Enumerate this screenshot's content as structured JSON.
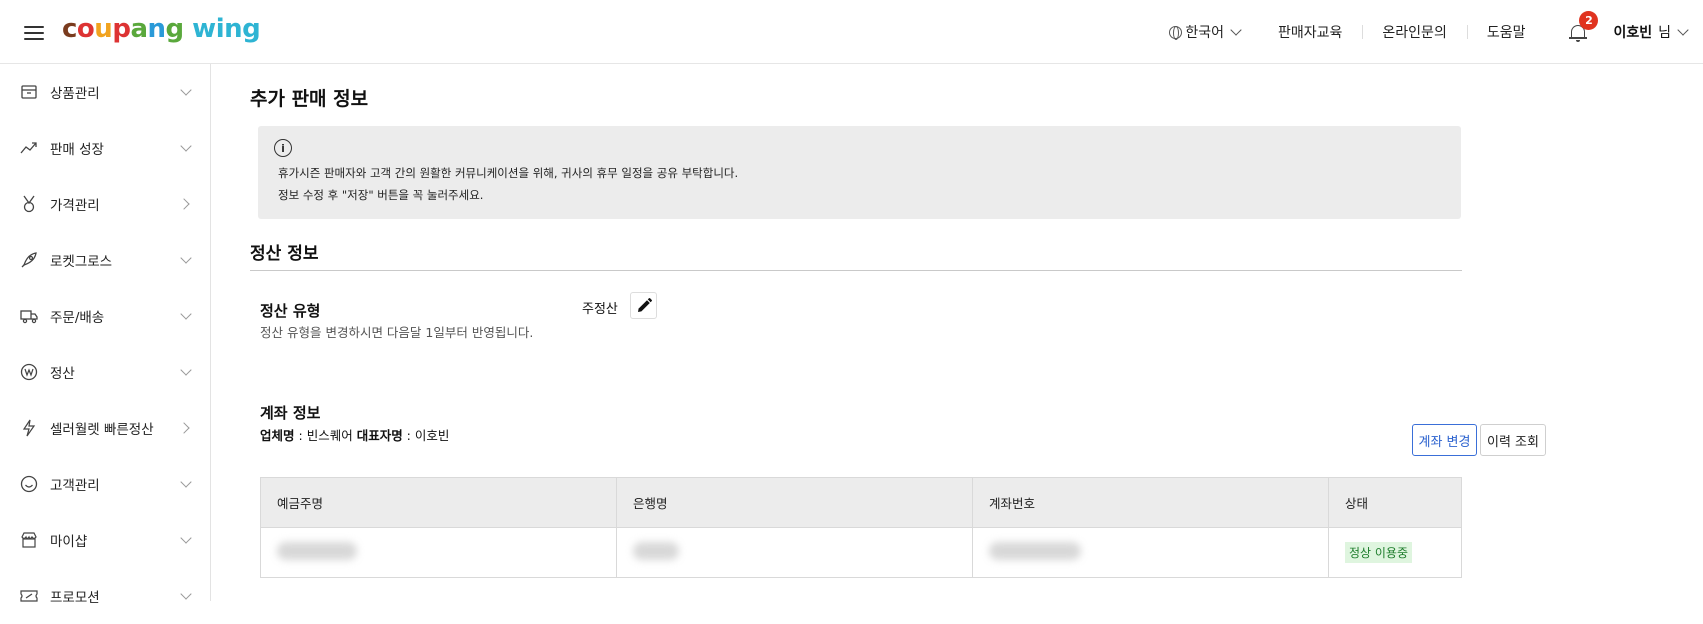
{
  "header": {
    "logo_parts": [
      "c",
      "o",
      "u",
      "p",
      "a",
      "n",
      "g"
    ],
    "logo_wing": " wing",
    "lang": "한국어",
    "links": [
      "판매자교육",
      "온라인문의",
      "도움말"
    ],
    "notif_count": "2",
    "user_name": "이호빈",
    "user_suffix": "님"
  },
  "sidebar": {
    "items": [
      {
        "label": "상품관리",
        "icon": "box-icon"
      },
      {
        "label": "판매 성장",
        "icon": "trend-icon"
      },
      {
        "label": "가격관리",
        "icon": "medal-icon"
      },
      {
        "label": "로켓그로스",
        "icon": "rocket-icon"
      },
      {
        "label": "주문/배송",
        "icon": "truck-icon"
      },
      {
        "label": "정산",
        "icon": "won-icon"
      },
      {
        "label": "셀러월렛 빠른정산",
        "icon": "lightning-icon"
      },
      {
        "label": "고객관리",
        "icon": "smile-icon"
      },
      {
        "label": "마이샵",
        "icon": "shop-icon"
      },
      {
        "label": "프로모션",
        "icon": "ticket-icon"
      }
    ]
  },
  "main": {
    "title": "추가 판매 정보",
    "notice_line1": "휴가시즌 판매자와 고객 간의 원활한 커뮤니케이션을 위해, 귀사의 휴무 일정을 공유 부탁합니다.",
    "notice_line2": "정보 수정 후 \"저장\" 버튼을 꼭 눌러주세요.",
    "settlement_title": "정산 정보",
    "settlement_type_label": "정산 유형",
    "settlement_type_desc": "정산 유형을 변경하시면 다음달 1일부터 반영됩니다.",
    "settlement_type_value": "주정산",
    "account_title": "계좌 정보",
    "company_label": "업체명",
    "company_value": "빈스퀘어",
    "rep_label": "대표자명",
    "rep_value": "이호빈",
    "change_account_btn": "계좌 변경",
    "history_btn": "이력 조회",
    "table": {
      "headers": [
        "예금주명",
        "은행명",
        "계좌번호",
        "상태"
      ],
      "status": "정상 이용중"
    }
  }
}
